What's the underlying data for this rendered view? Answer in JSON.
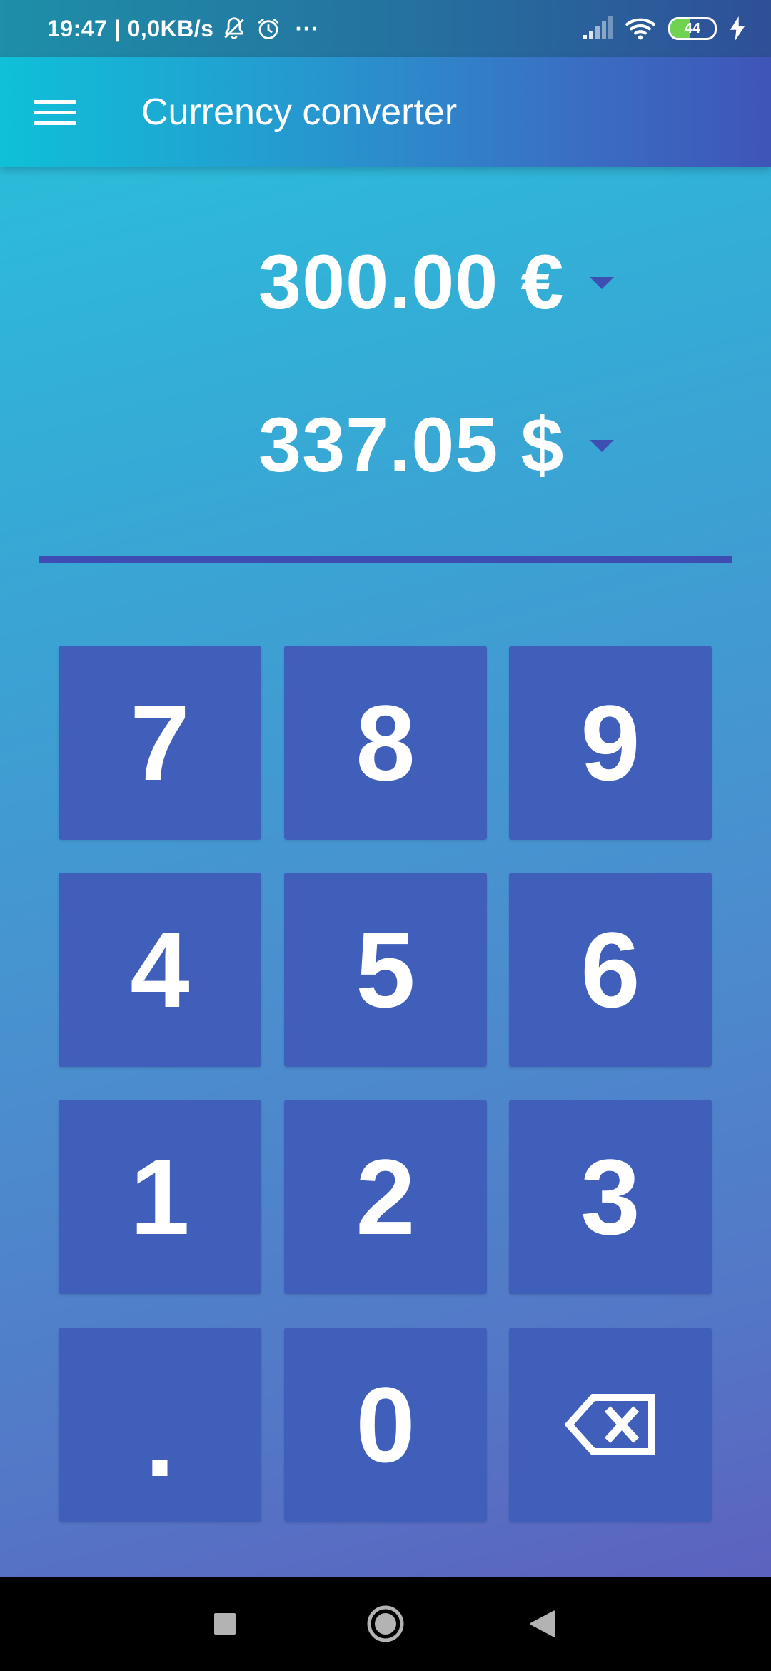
{
  "status_bar": {
    "time_and_speed": "19:47 | 0,0KB/s",
    "more_label": "···",
    "battery_level": "44",
    "battery_fraction": 0.44,
    "battery_color": "#6fd250"
  },
  "app_bar": {
    "title": "Currency converter",
    "menu_icon": "hamburger-menu-icon"
  },
  "converter": {
    "source": {
      "amount": "300.00 €",
      "dropdown_icon": "dropdown-arrow-icon"
    },
    "target": {
      "amount": "337.05 $",
      "dropdown_icon": "dropdown-arrow-icon"
    }
  },
  "keypad": {
    "keys": [
      "7",
      "8",
      "9",
      "4",
      "5",
      "6",
      "1",
      "2",
      "3",
      ".",
      "0"
    ],
    "backspace_icon": "backspace-icon",
    "key_color": "#3f5fbb"
  },
  "nav_bar": {
    "recents_icon": "recents-square-icon",
    "home_icon": "home-circle-icon",
    "back_icon": "back-triangle-icon"
  }
}
